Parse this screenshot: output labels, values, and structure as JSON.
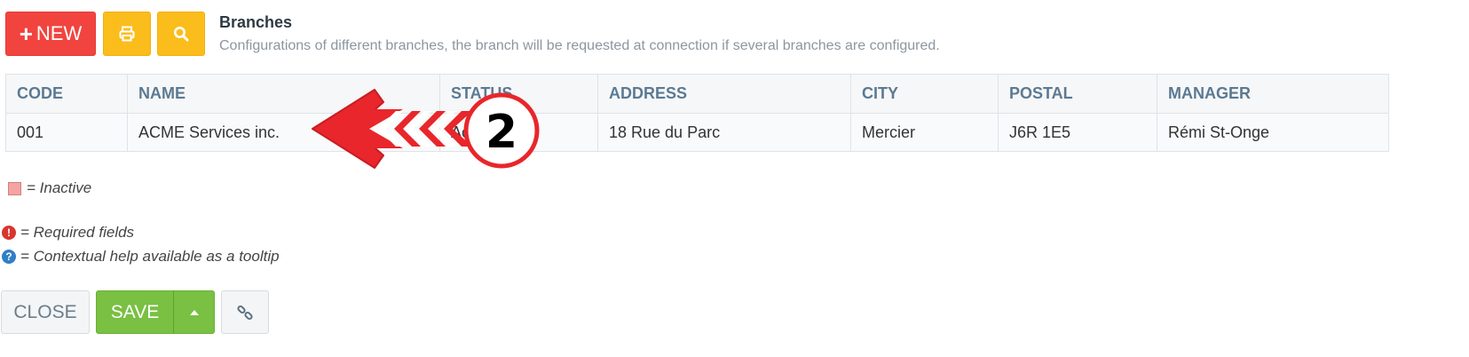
{
  "toolbar": {
    "new_label": "NEW",
    "new_plus": "+"
  },
  "header": {
    "title": "Branches",
    "subtitle": "Configurations of different branches, the branch will be requested at connection if several branches are configured."
  },
  "table": {
    "columns": [
      "CODE",
      "NAME",
      "STATUS",
      "ADDRESS",
      "CITY",
      "POSTAL",
      "MANAGER"
    ],
    "rows": [
      [
        "001",
        "ACME Services inc.",
        "Active",
        "18 Rue du Parc",
        "Mercier",
        "J6R 1E5",
        "Rémi St-Onge"
      ]
    ]
  },
  "legend": {
    "inactive": "= Inactive",
    "required": "= Required fields",
    "help": "= Contextual help available as a tooltip",
    "required_glyph": "!",
    "help_glyph": "?"
  },
  "footer": {
    "close_label": "CLOSE",
    "save_label": "SAVE"
  },
  "annotation": {
    "step_number": "2"
  },
  "colors": {
    "new_button": "#f2443f",
    "yellow_buttons": "#fbbd1c",
    "save_button": "#79c043",
    "header_text": "#5b7a92",
    "annotation_red": "#e8262b"
  },
  "icons": {
    "print": "printer-icon",
    "search": "search-icon",
    "caret": "caret-up-icon",
    "link": "link-icon"
  }
}
